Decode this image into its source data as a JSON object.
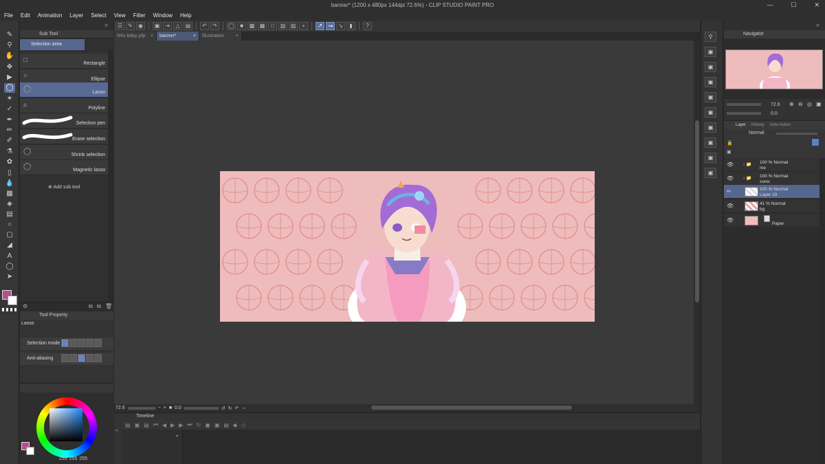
{
  "window": {
    "title": "banner* (1200 x 480px 144dpi 72.6%) - CLIP STUDIO PAINT PRO"
  },
  "menu": [
    "File",
    "Edit",
    "Animation",
    "Layer",
    "Select",
    "View",
    "Filter",
    "Window",
    "Help"
  ],
  "tabs": [
    {
      "label": "felix bday pfp"
    },
    {
      "label": "banner*"
    },
    {
      "label": "Illustration"
    }
  ],
  "subtool": {
    "panel_title": "Sub Tool",
    "group": "Selection area",
    "items": [
      {
        "label": "Rectangle",
        "icon": "rectangle-select-icon"
      },
      {
        "label": "Ellipse",
        "icon": "ellipse-select-icon"
      },
      {
        "label": "Lasso",
        "icon": "lasso-icon",
        "active": true
      },
      {
        "label": "Polyline",
        "icon": "polyline-icon"
      },
      {
        "label": "Selection pen",
        "icon": "selection-pen-icon"
      },
      {
        "label": "Erase selection",
        "icon": "erase-selection-icon"
      },
      {
        "label": "Shrink selection",
        "icon": "shrink-selection-icon"
      },
      {
        "label": "Magnetic lasso",
        "icon": "magnetic-lasso-icon"
      }
    ],
    "add_label": "Add sub tool"
  },
  "tool_property": {
    "panel_title": "Tool Property",
    "tool_name": "Lasso",
    "selection_mode_label": "Selection mode",
    "anti_aliasing_label": "Anti-aliasing"
  },
  "color": {
    "r": "255",
    "g": "255",
    "b": "255",
    "main_color": "#b44f8f",
    "sub_color": "#ffffff"
  },
  "status": {
    "zoom": "72.6",
    "rotation": "0.0"
  },
  "timeline": {
    "panel_title": "Timeline"
  },
  "navigator": {
    "panel_title": "Navigator",
    "zoom": "72.6",
    "rotation": "0.0"
  },
  "layer_panel": {
    "tabs": [
      "Layer",
      "History",
      "Auto Action"
    ],
    "blend_mode": "Normal",
    "layers": [
      {
        "line1": "100 % Normal",
        "line2": "me",
        "type": "folder"
      },
      {
        "line1": "100 % Normal",
        "line2": "sonic",
        "type": "folder"
      },
      {
        "line1": "100 % Normal",
        "line2": "Layer 19",
        "type": "raster",
        "active": true
      },
      {
        "line1": "41 % Normal",
        "line2": "bg",
        "type": "raster"
      },
      {
        "line1": "",
        "line2": "Paper",
        "type": "paper"
      }
    ]
  },
  "colors": {
    "accent": "#586a94",
    "artwork_bg": "#eebcbc",
    "sketch": "#e08a8a"
  }
}
